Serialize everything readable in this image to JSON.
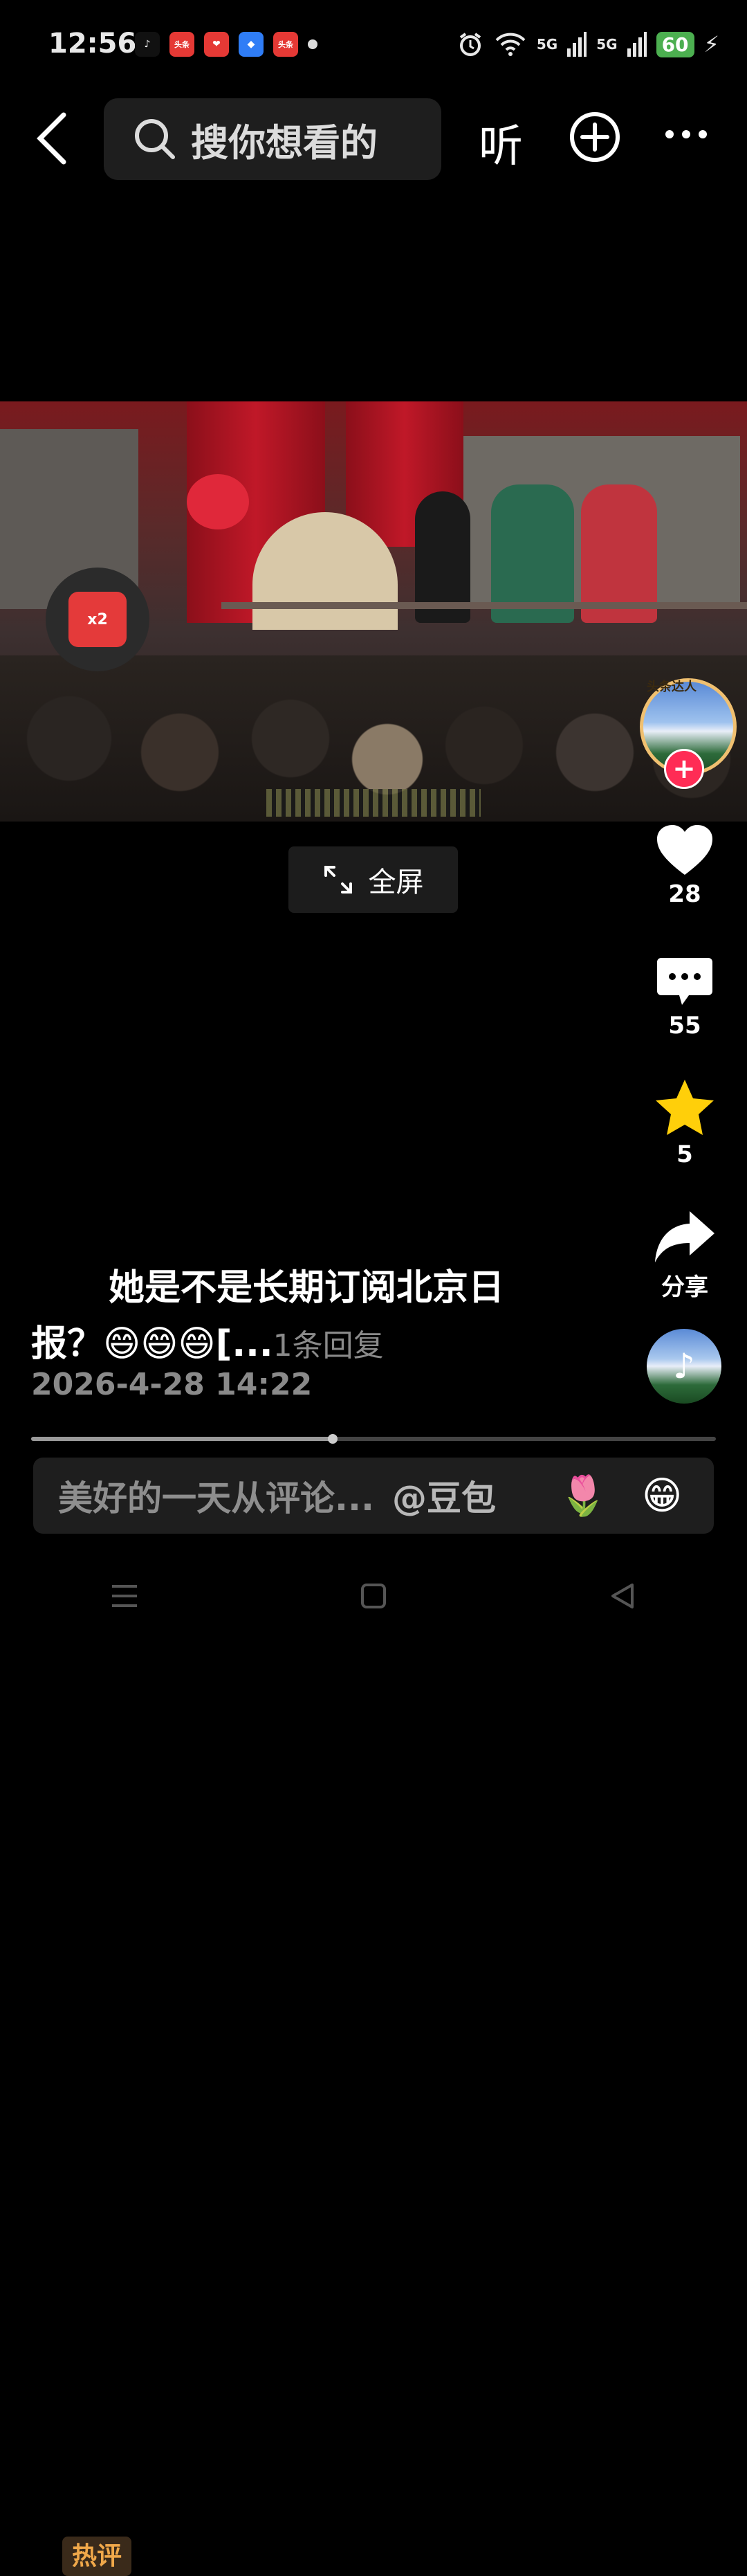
{
  "status_bar": {
    "time": "12:56",
    "apps": [
      {
        "name": "tiktok-icon",
        "label": "♪",
        "color": "#111111"
      },
      {
        "name": "toutiao-icon",
        "label": "头条",
        "color": "#e53935"
      },
      {
        "name": "gift-icon",
        "label": "❤",
        "color": "#e53935"
      },
      {
        "name": "blue-app-icon",
        "label": "◆",
        "color": "#2f7df6"
      },
      {
        "name": "toutiao-lite-icon",
        "label": "头条",
        "color": "#e53935"
      }
    ],
    "network1": "5G",
    "network2": "5G",
    "battery": "60"
  },
  "top_nav": {
    "search_placeholder": "搜你想看的",
    "listen_label": "听"
  },
  "video": {
    "fullscreen_label": "全屏",
    "creator_badge": "头条达人",
    "reward_multiplier": "x2"
  },
  "actions": {
    "likes": "28",
    "comments": "55",
    "favorites": "5",
    "share_label": "分享"
  },
  "hot_comment": {
    "tag": "热评",
    "text": "她是不是长期订阅北京日报？😄😄😄[...",
    "replies": "1条回复",
    "date": "2026-4-28 14:22"
  },
  "progress": {
    "played_fraction": 0.44
  },
  "comment_input": {
    "placeholder": "美好的一天从评论...",
    "mention": "@豆包",
    "emoji1": "🌷",
    "emoji2": "😁"
  }
}
